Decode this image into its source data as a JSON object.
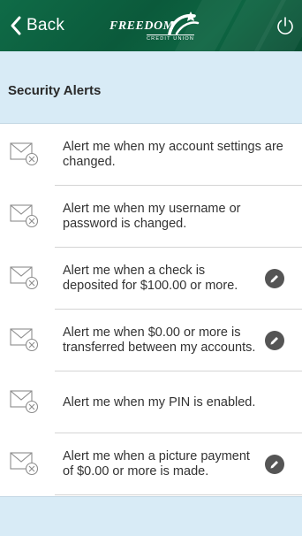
{
  "header": {
    "back_label": "Back",
    "logo_text": "FREEDOM",
    "logo_subtext": "CREDIT UNION",
    "brand_color": "#0b5a3b"
  },
  "section": {
    "title": "Security Alerts",
    "background": "#d8ebf6"
  },
  "alerts": [
    {
      "text": "Alert me when my account settings are changed.",
      "editable": false
    },
    {
      "text": "Alert me when my username or password is changed.",
      "editable": false
    },
    {
      "text": "Alert me when a check is deposited for $100.00 or more.",
      "editable": true
    },
    {
      "text": "Alert me when $0.00 or more is transferred between my accounts.",
      "editable": true
    },
    {
      "text": "Alert me when my PIN is enabled.",
      "editable": false
    },
    {
      "text": "Alert me when a picture payment of $0.00 or more is made.",
      "editable": true
    }
  ],
  "icons": {
    "back": "chevron-left-icon",
    "power": "power-icon",
    "alert_off": "mail-disabled-icon",
    "edit": "pencil-icon"
  }
}
